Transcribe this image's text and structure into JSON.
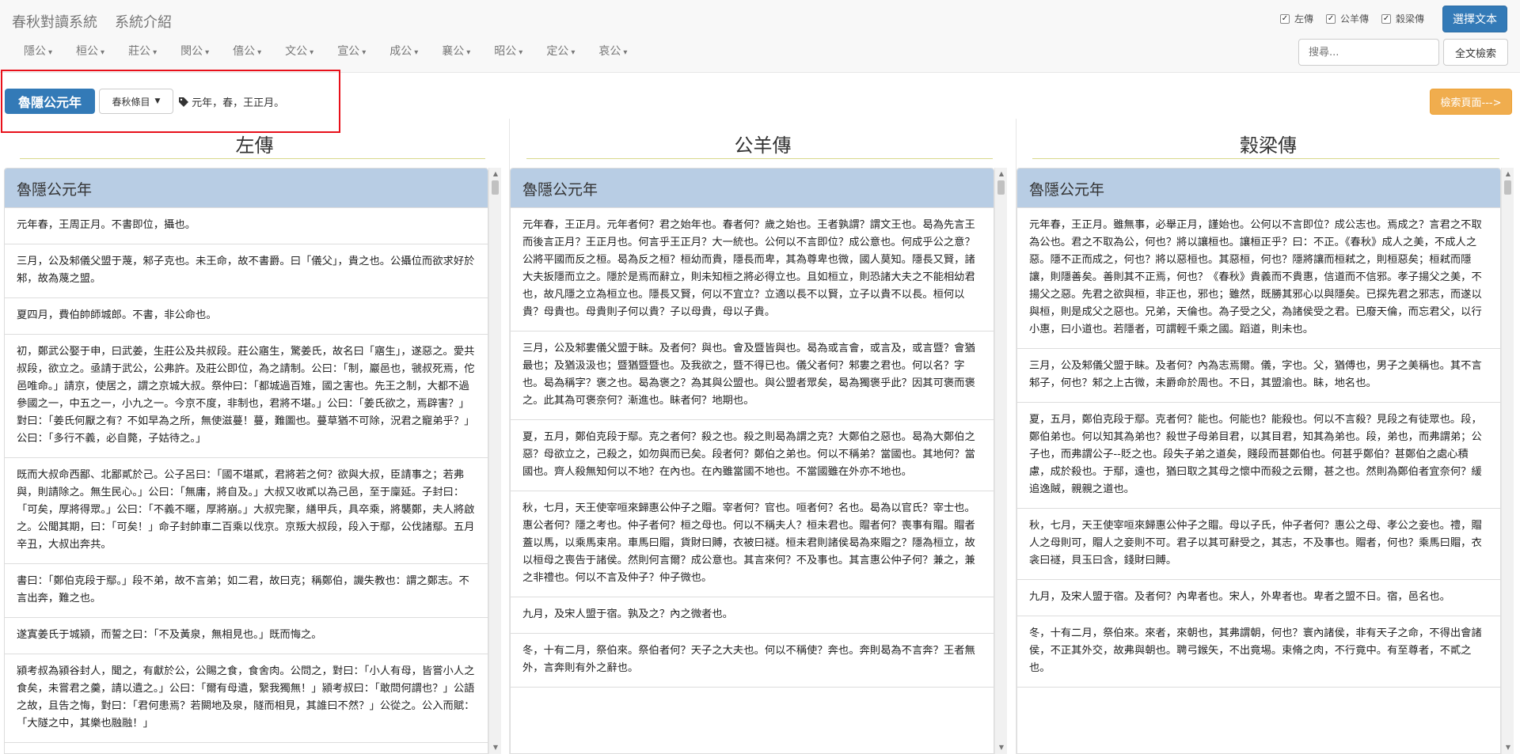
{
  "navbar": {
    "brand": "春秋對讀系統",
    "intro_link": "系統介紹",
    "menu": [
      "隱公",
      "桓公",
      "莊公",
      "閔公",
      "僖公",
      "文公",
      "宣公",
      "成公",
      "襄公",
      "昭公",
      "定公",
      "哀公"
    ],
    "checkboxes": [
      {
        "label": "左傳",
        "checked": true
      },
      {
        "label": "公羊傳",
        "checked": true
      },
      {
        "label": "穀梁傳",
        "checked": true
      }
    ],
    "select_text_button": "選擇文本",
    "search_placeholder": "搜尋...",
    "fulltext_search_button": "全文檢索"
  },
  "toolbar": {
    "year_badge": "魯隱公元年",
    "dropdown_label": "春秋條目",
    "tag_text": "元年，春，王正月。",
    "search_page_button": "檢索頁面--->"
  },
  "colors": {
    "primary": "#337ab7",
    "warning": "#f0ad4e",
    "panel_heading": "#b8cde4",
    "highlight_border": "#e8101a"
  },
  "columns": [
    {
      "title": "左傳",
      "heading": "魯隱公元年",
      "entries": [
        "元年春，王周正月。不書即位，攝也。",
        "三月，公及邾儀父盟于蔑，邾子克也。未王命，故不書爵。曰「儀父」，貴之也。公攝位而欲求好於邾，故為蔑之盟。",
        "夏四月，費伯帥師城郎。不書，非公命也。",
        "初，鄭武公娶于申，曰武姜，生莊公及共叔段。莊公寤生，驚姜氏，故名曰「寤生」，遂惡之。愛共叔段，欲立之。亟請于武公，公弗許。及莊公即位，為之請制。公曰：「制，巖邑也，虢叔死焉，佗邑唯命。」請京，使居之，謂之京城大叔。祭仲曰：「都城過百雉，國之害也。先王之制，大都不過參國之一，中五之一，小九之一。今京不度，非制也，君將不堪。」公曰：「姜氏欲之，焉辟害？」對曰：「姜氏何厭之有？不如早為之所，無使滋蔓！蔓，難圖也。蔓草猶不可除，況君之寵弟乎？」公曰：「多行不義，必自斃，子姑待之。」",
        "既而大叔命西鄙、北鄙貳於己。公子呂曰：「國不堪貳，君將若之何？欲與大叔，臣請事之；若弗與，則請除之。無生民心。」公曰：「無庸，將自及。」大叔又收貳以為己邑，至于廩延。子封曰：「可矣，厚將得眾。」公曰：「不義不暱，厚將崩。」大叔完聚，繕甲兵，具卒乘，將襲鄭，夫人將啟之。公聞其期，曰：「可矣！」命子封帥車二百乘以伐京。京叛大叔段，段入于鄢，公伐諸鄢。五月辛丑，大叔出奔共。",
        "書曰：「鄭伯克段于鄢。」段不弟，故不言弟；如二君，故曰克；稱鄭伯，譏失教也：謂之鄭志。不言出奔，難之也。",
        "遂寘姜氏于城潁，而誓之曰：「不及黃泉，無相見也。」既而悔之。",
        "潁考叔為潁谷封人，聞之，有獻於公，公賜之食，食舍肉。公問之，對曰：「小人有母，皆嘗小人之食矣，未嘗君之羹，請以遺之。」公曰：「爾有母遺，繄我獨無！」潁考叔曰：「敢問何謂也？」公語之故，且告之悔，對曰：「君何患焉？若闕地及泉，隧而相見，其誰曰不然？」公從之。公入而賦：「大隧之中，其樂也融融！」"
      ]
    },
    {
      "title": "公羊傳",
      "heading": "魯隱公元年",
      "entries": [
        "元年春，王正月。元年者何？君之始年也。春者何？歲之始也。王者孰謂？謂文王也。曷為先言王而後言正月？王正月也。何言乎王正月？大一統也。公何以不言即位？成公意也。何成乎公之意？公將平國而反之桓。曷為反之桓？桓幼而貴，隱長而卑，其為尊卑也微，國人莫知。隱長又賢，諸大夫扳隱而立之。隱於是焉而辭立，則未知桓之將必得立也。且如桓立，則恐諸大夫之不能相幼君也，故凡隱之立為桓立也。隱長又賢，何以不宜立？立適以長不以賢，立子以貴不以長。桓何以貴？母貴也。母貴則子何以貴？子以母貴，母以子貴。",
        "三月，公及邾婁儀父盟于眛。及者何？與也。會及暨皆與也。曷為或言會，或言及，或言暨？會猶最也；及猶汲汲也；暨猶暨暨也。及我欲之，暨不得已也。儀父者何？邾婁之君也。何以名？字也。曷為稱字？褒之也。曷為褒之？為其與公盟也。與公盟者眾矣，曷為獨褒乎此？因其可褒而褒之。此其為可褒奈何？漸進也。眛者何？地期也。",
        "夏，五月，鄭伯克段于鄢。克之者何？殺之也。殺之則曷為謂之克？大鄭伯之惡也。曷為大鄭伯之惡？母欲立之，己殺之，如勿與而已矣。段者何？鄭伯之弟也。何以不稱弟？當國也。其地何？當國也。齊人殺無知何以不地？在內也。在內雖當國不地也。不當國雖在外亦不地也。",
        "秋，七月，天王使宰咺來歸惠公仲子之賵。宰者何？官也。咺者何？名也。曷為以官氏？宰士也。惠公者何？隱之考也。仲子者何？桓之母也。何以不稱夫人？桓未君也。賵者何？喪事有賵。賵者蓋以馬，以乘馬束帛。車馬曰賵，貨財曰賻，衣被曰襚。桓未君則諸侯曷為來賵之？隱為桓立，故以桓母之喪告于諸侯。然則何言爾？成公意也。其言來何？不及事也。其言惠公仲子何？兼之，兼之非禮也。何以不言及仲子？仲子微也。",
        "九月，及宋人盟于宿。孰及之？內之微者也。",
        "冬，十有二月，祭伯來。祭伯者何？天子之大夫也。何以不稱使？奔也。奔則曷為不言奔？王者無外，言奔則有外之辭也。"
      ]
    },
    {
      "title": "穀梁傳",
      "heading": "魯隱公元年",
      "entries": [
        "元年春，王正月。雖無事，必舉正月，謹始也。公何以不言即位？成公志也。焉成之？言君之不取為公也。君之不取為公，何也？將以讓桓也。讓桓正乎？曰：不正。《春秋》成人之美，不成人之惡。隱不正而成之，何也？將以惡桓也。其惡桓，何也？隱將讓而桓弒之，則桓惡矣；桓弒而隱讓，則隱善矣。善則其不正焉，何也？《春秋》貴義而不貴惠，信道而不信邪。孝子揚父之美，不揚父之惡。先君之欲與桓，非正也，邪也；雖然，既勝其邪心以與隱矣。已探先君之邪志，而遂以與桓，則是成父之惡也。兄弟，天倫也。為子受之父，為諸侯受之君。已廢天倫，而忘君父，以行小惠，曰小道也。若隱者，可謂輕千乘之國。蹈道，則未也。",
        "三月，公及邾儀父盟于眛。及者何？內為志焉爾。儀，字也。父，猶傅也，男子之美稱也。其不言邾子，何也？邾之上古微，未爵命於周也。不日，其盟渝也。眛，地名也。",
        "夏，五月，鄭伯克段于鄢。克者何？能也。何能也？能殺也。何以不言殺？見段之有徒眾也。段，鄭伯弟也。何以知其為弟也？殺世子母弟目君，以其目君，知其為弟也。段，弟也，而弗謂弟；公子也，而弗謂公子--貶之也。段失子弟之道矣，賤段而甚鄭伯也。何甚乎鄭伯？甚鄭伯之處心積慮，成於殺也。于鄢，遠也，猶曰取之其母之懷中而殺之云爾，甚之也。然則為鄭伯者宜奈何？緩追逸賊，親親之道也。",
        "秋，七月，天王使宰咺來歸惠公仲子之賵。母以子氏，仲子者何？惠公之母、孝公之妾也。禮，賵人之母則可，賵人之妾則不可。君子以其可辭受之，其志，不及事也。賵者，何也？乘馬曰賵，衣衾曰襚，貝玉曰含，錢財曰賻。",
        "九月，及宋人盟于宿。及者何？內卑者也。宋人，外卑者也。卑者之盟不日。宿，邑名也。",
        "冬，十有二月，祭伯來。來者，來朝也，其弗謂朝，何也？寰內諸侯，非有天子之命，不得出會諸侯，不正其外交，故弗與朝也。聘弓鍭矢，不出竟埸。束脩之肉，不行竟中。有至尊者，不貳之也。"
      ]
    }
  ]
}
